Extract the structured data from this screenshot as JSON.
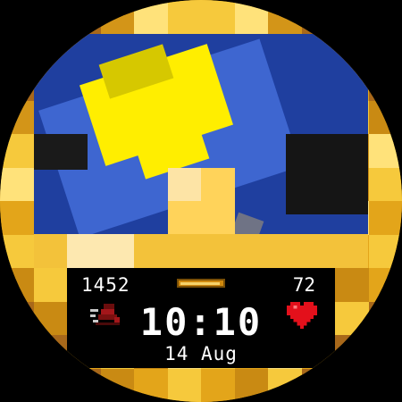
{
  "watchface": {
    "steps": "1452",
    "battery": "72",
    "time": "10:10",
    "date": "14 Aug",
    "power_level": 0.95,
    "icons": {
      "steps": "boot-icon",
      "battery": "heart-icon",
      "power": "power-bar-icon"
    },
    "colors": {
      "gold": "#e3a51a",
      "sky_blue": "#2f5fc4",
      "sun_yellow": "#ffee00",
      "heart_red": "#e3101b",
      "panel_bg": "#000000"
    }
  }
}
